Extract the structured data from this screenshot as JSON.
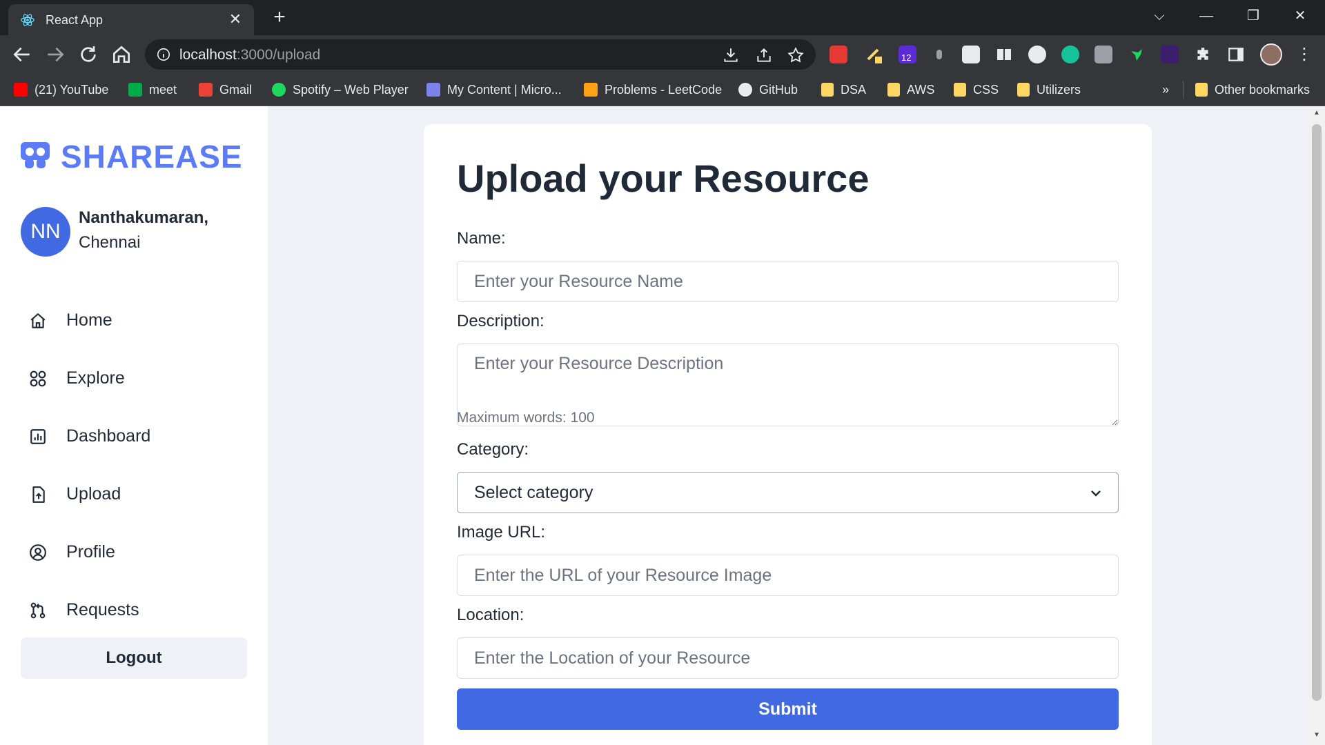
{
  "browser": {
    "tab_title": "React App",
    "url_host": "localhost",
    "url_path": ":3000/upload",
    "ext_badge": "12",
    "bookmarks": [
      {
        "label": "(21) YouTube",
        "icon": "youtube-icon",
        "color": "#ff0000"
      },
      {
        "label": "meet",
        "icon": "meet-icon",
        "color": "#00ac47"
      },
      {
        "label": "Gmail",
        "icon": "gmail-icon",
        "color": "#ea4335"
      },
      {
        "label": "Spotify – Web Player",
        "icon": "spotify-icon",
        "color": "#1ed760"
      },
      {
        "label": "My Content | Micro...",
        "icon": "microsoft-icon",
        "color": "#7b83eb"
      },
      {
        "label": "Problems - LeetCode",
        "icon": "leetcode-icon",
        "color": "#ffa116"
      },
      {
        "label": "GitHub",
        "icon": "github-icon",
        "color": "#e8eaed"
      },
      {
        "label": "DSA",
        "icon": "folder-icon",
        "color": "#fdd663"
      },
      {
        "label": "AWS",
        "icon": "folder-icon",
        "color": "#fdd663"
      },
      {
        "label": "CSS",
        "icon": "folder-icon",
        "color": "#fdd663"
      },
      {
        "label": "Utilizers",
        "icon": "folder-icon",
        "color": "#fdd663"
      }
    ],
    "more_bookmarks": "»",
    "other_bookmarks": "Other bookmarks"
  },
  "sidebar": {
    "logo": "SHAREASE",
    "avatar_initials": "NN",
    "user_name": "Nanthakumaran,",
    "user_city": "Chennai",
    "nav": [
      {
        "label": "Home",
        "icon": "home-icon"
      },
      {
        "label": "Explore",
        "icon": "grid-icon"
      },
      {
        "label": "Dashboard",
        "icon": "chart-icon"
      },
      {
        "label": "Upload",
        "icon": "upload-file-icon"
      },
      {
        "label": "Profile",
        "icon": "user-circle-icon"
      },
      {
        "label": "Requests",
        "icon": "pull-request-icon"
      }
    ],
    "logout": "Logout"
  },
  "form": {
    "title": "Upload your Resource",
    "name_label": "Name:",
    "name_placeholder": "Enter your Resource Name",
    "description_label": "Description:",
    "description_placeholder": "Enter your Resource Description",
    "description_hint": "Maximum words: 100",
    "category_label": "Category:",
    "category_value": "Select category",
    "image_label": "Image URL:",
    "image_placeholder": "Enter the URL of your Resource Image",
    "location_label": "Location:",
    "location_placeholder": "Enter the Location of your Resource",
    "submit": "Submit"
  },
  "colors": {
    "accent": "#4169e1",
    "logo": "#5b7cf6",
    "page_bg": "#eef2f6"
  }
}
